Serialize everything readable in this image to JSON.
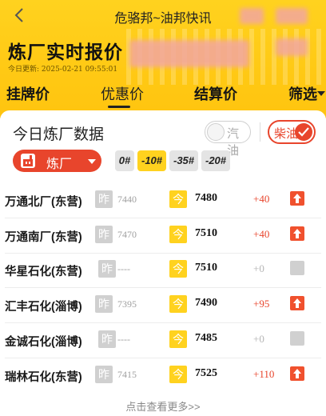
{
  "nav": {
    "title": "危骆邦~油邦快讯",
    "back_icon": "chevron-left-icon"
  },
  "header": {
    "title": "炼厂实时报价",
    "update_time": "今日更新: 2025-02-21 09:55:01"
  },
  "tabs": [
    {
      "label": "挂牌价",
      "active": false
    },
    {
      "label": "优惠价",
      "active": true
    },
    {
      "label": "结算价",
      "active": false
    },
    {
      "label": "筛选",
      "active": false
    }
  ],
  "panel": {
    "title": "今日炼厂数据",
    "toggle_gasoline": {
      "label": "汽油",
      "on": false
    },
    "toggle_diesel": {
      "label": "柴油",
      "on": true
    },
    "factory_button": {
      "label": "炼厂"
    },
    "grades": [
      {
        "label": "0#",
        "active": false
      },
      {
        "label": "-10#",
        "active": true
      },
      {
        "label": "-35#",
        "active": false
      },
      {
        "label": "-20#",
        "active": false
      }
    ]
  },
  "table": {
    "yesterday_badge": "昨",
    "today_badge": "今",
    "rows": [
      {
        "name": "万通北厂(东营)",
        "prev": "7440",
        "cur": "7480",
        "change": "+40",
        "trend": "up"
      },
      {
        "name": "万通南厂(东营)",
        "prev": "7470",
        "cur": "7510",
        "change": "+40",
        "trend": "up"
      },
      {
        "name": "华星石化(东营)",
        "prev": "----",
        "cur": "7510",
        "change": "+0",
        "trend": "none"
      },
      {
        "name": "汇丰石化(淄博)",
        "prev": "7395",
        "cur": "7490",
        "change": "+95",
        "trend": "up"
      },
      {
        "name": "金诚石化(淄博)",
        "prev": "----",
        "cur": "7485",
        "change": "+0",
        "trend": "none"
      },
      {
        "name": "瑞林石化(东营)",
        "prev": "7415",
        "cur": "7525",
        "change": "+110",
        "trend": "up"
      }
    ]
  },
  "more_link": "点击查看更多>>",
  "colors": {
    "brand_yellow": "#ffd21f",
    "accent_red": "#e8452c",
    "up_red": "#f0512e",
    "muted_gray": "#d0d0d0"
  }
}
